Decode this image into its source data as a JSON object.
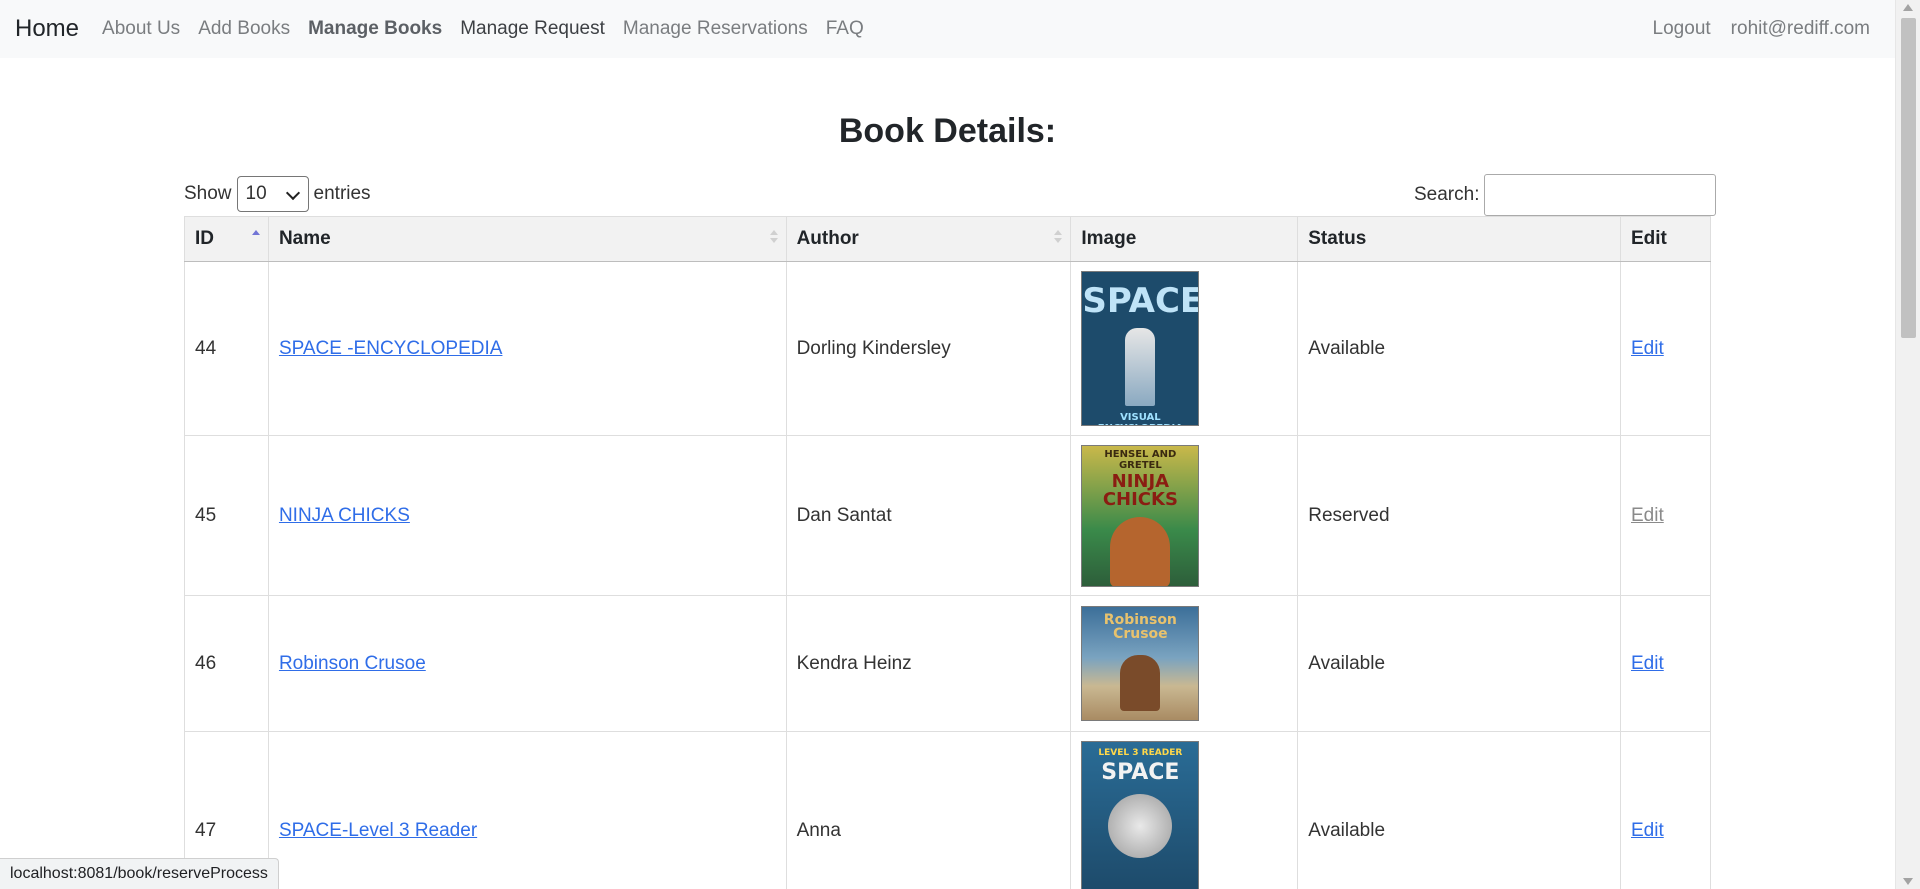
{
  "nav": {
    "brand": "Home",
    "links": [
      "About Us",
      "Add Books",
      "Manage Books",
      "Manage Request",
      "Manage Reservations",
      "FAQ"
    ],
    "right": [
      "Logout",
      "rohit@rediff.com"
    ]
  },
  "page": {
    "title": "Book Details:",
    "show_label": "Show",
    "entries_value": "10",
    "entries_label": "entries",
    "search_label": "Search:",
    "search_value": ""
  },
  "table": {
    "headers": [
      "ID",
      "Name",
      "Author",
      "Image",
      "Status",
      "Edit"
    ],
    "rows": [
      {
        "id": "44",
        "name": "SPACE -ENCYCLOPEDIA",
        "author": "Dorling Kindersley",
        "status": "Available",
        "edit": "Edit",
        "cover_text": "SPACE",
        "cover_sub": "VISUAL ENCYCLOPEDIA",
        "cover_color": "#1d4b6b",
        "cover_fg": "#bfe3f7"
      },
      {
        "id": "45",
        "name": "NINJA CHICKS",
        "author": "Dan Santat",
        "status": "Reserved",
        "edit": "Edit",
        "cover_text": "NINJA CHICKS",
        "cover_sub": "HENSEL AND GRETEL",
        "cover_color": "#9aa33c",
        "cover_fg": "#8a1d12"
      },
      {
        "id": "46",
        "name": "Robinson Crusoe",
        "author": "Kendra Heinz",
        "status": "Available",
        "edit": "Edit",
        "cover_text": "Robinson Crusoe",
        "cover_sub": "",
        "cover_color": "#3c6f99",
        "cover_fg": "#e8c26d"
      },
      {
        "id": "47",
        "name": "SPACE-Level 3 Reader",
        "author": "Anna",
        "status": "Available",
        "edit": "Edit",
        "cover_text": "SPACE",
        "cover_sub": "LEVEL 3 READER",
        "cover_color": "#2a6c96",
        "cover_fg": "#f2f2f2"
      }
    ]
  },
  "status_bar": {
    "url": "localhost:8081/book/reserveProcess"
  },
  "colors": {
    "link": "#2f6de8",
    "disabled_link": "#8a8a8a",
    "sort_active": "#7275d6"
  }
}
